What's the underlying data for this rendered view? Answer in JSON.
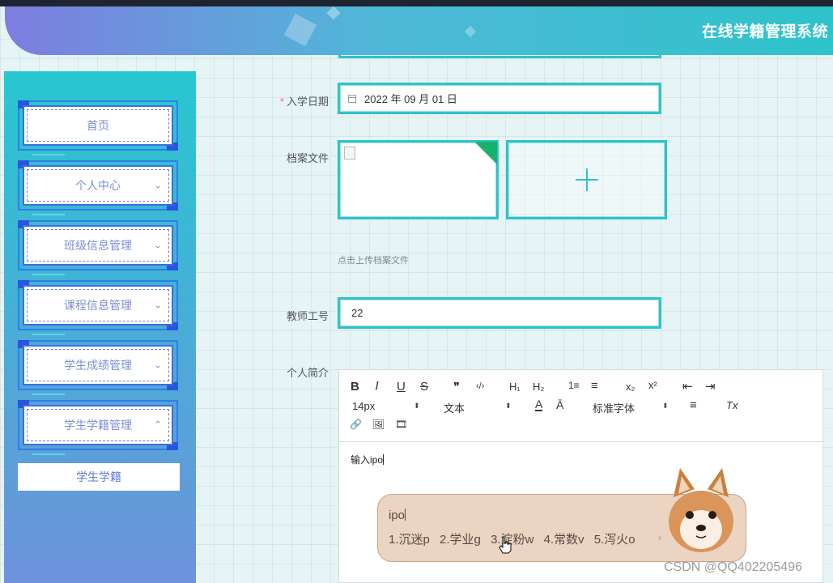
{
  "app": {
    "title": "在线学籍管理系统"
  },
  "sidebar": {
    "items": [
      {
        "label": "首页",
        "has_chevron": false
      },
      {
        "label": "个人中心",
        "has_chevron": true,
        "chevron": "⌄"
      },
      {
        "label": "班级信息管理",
        "has_chevron": true,
        "chevron": "⌄"
      },
      {
        "label": "课程信息管理",
        "has_chevron": true,
        "chevron": "⌄"
      },
      {
        "label": "学生成绩管理",
        "has_chevron": true,
        "chevron": "⌄"
      },
      {
        "label": "学生学籍管理",
        "has_chevron": true,
        "chevron": "⌃",
        "expanded": true
      }
    ],
    "submenu": {
      "label": "学生学籍"
    }
  },
  "form": {
    "enroll_date": {
      "required_mark": "*",
      "label": "入学日期",
      "value": "2022 年 09 月 01 日"
    },
    "archive_file": {
      "label": "档案文件",
      "hint": "点击上传档案文件"
    },
    "teacher_id": {
      "label": "教师工号",
      "value": "22"
    },
    "profile": {
      "label": "个人简介"
    }
  },
  "editor": {
    "toolbar": {
      "bold": "B",
      "italic": "I",
      "underline": "U",
      "strike": "S",
      "quote": "❞",
      "code": "‹/›",
      "h1": "H₁",
      "h2": "H₂",
      "ordered_list": "1≡",
      "bullet_list": "≡",
      "subscript": "x₂",
      "superscript": "x²",
      "outdent": "⇤",
      "indent": "⇥",
      "size_select": "14px",
      "header_select": "文本",
      "font_color": "A",
      "background": "Ā",
      "font_select": "标准字体",
      "align": "≡",
      "clean": "Tx",
      "link": "🔗",
      "image": "🖼",
      "video": "🎞",
      "select_arrow": "⬍"
    },
    "content": "输入ipo"
  },
  "ime": {
    "input": "ipo",
    "candidates": [
      "1.沉迷p",
      "2.学业g",
      "3.淀粉w",
      "4.常数v",
      "5.泻火o"
    ],
    "next": "›"
  },
  "watermark": "CSDN @QQ402205496"
}
